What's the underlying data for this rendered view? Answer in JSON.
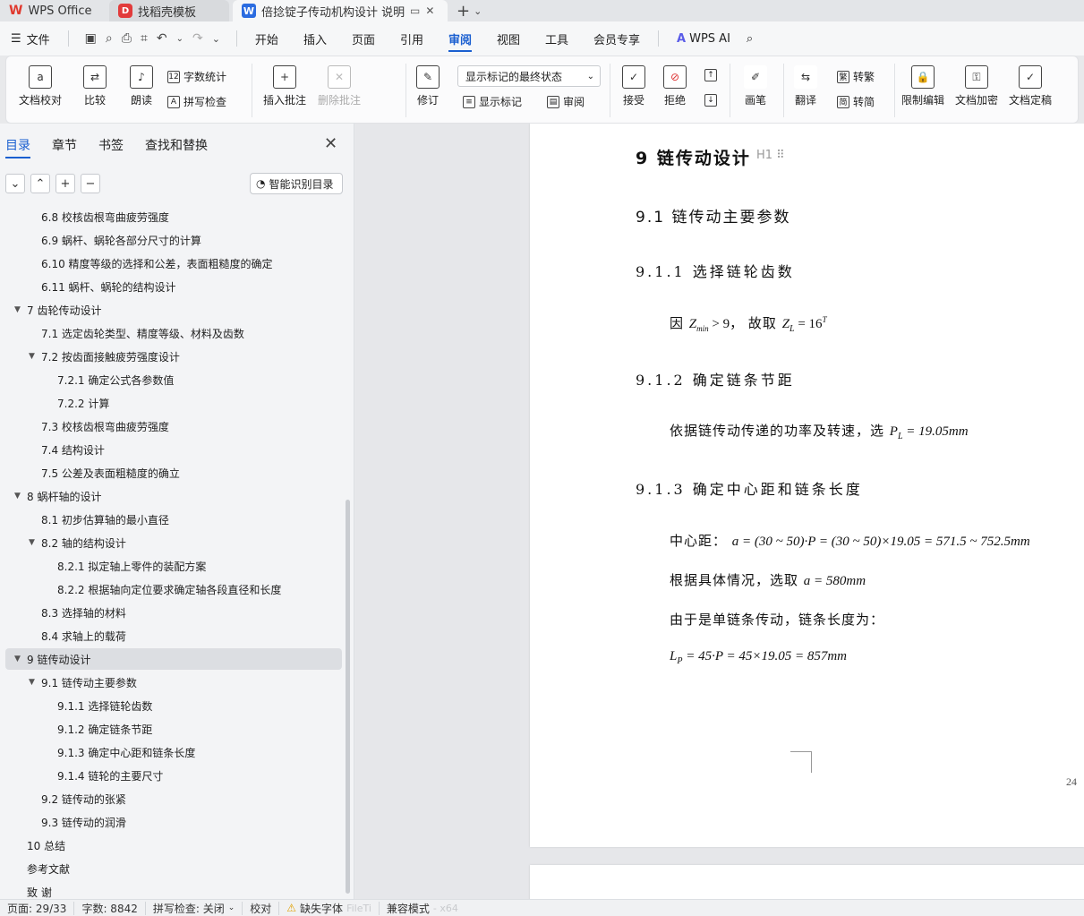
{
  "tabs": [
    {
      "label": "WPS Office"
    },
    {
      "label": "找稻壳模板"
    },
    {
      "label": "倍捻锭子传动机构设计 说明书"
    }
  ],
  "menu": {
    "file": "文件",
    "items": [
      "开始",
      "插入",
      "页面",
      "引用",
      "审阅",
      "视图",
      "工具",
      "会员专享"
    ],
    "active": "审阅",
    "ai": "WPS AI"
  },
  "ribbon": {
    "proofread": "文档校对",
    "compare": "比较",
    "read_aloud": "朗读",
    "word_count": "字数统计",
    "spell_check": "拼写检查",
    "insert_comment": "插入批注",
    "delete_comment": "删除批注",
    "markup_state": "显示标记的最终状态",
    "track": "修订",
    "show_markup": "显示标记",
    "review": "审阅",
    "accept": "接受",
    "reject": "拒绝",
    "pen": "画笔",
    "translate": "翻译",
    "to_traditional": "转繁",
    "to_simplified": "转简",
    "restrict": "限制编辑",
    "encrypt": "文档加密",
    "finalize": "文档定稿"
  },
  "sidebar": {
    "tabs": [
      "目录",
      "章节",
      "书签",
      "查找和替换"
    ],
    "active_tab": "目录",
    "smart_toc": "智能识别目录",
    "items": [
      {
        "text": "6.8  校核齿根弯曲疲劳强度",
        "level": 2,
        "arrow": ""
      },
      {
        "text": "6.9  蜗杆、蜗轮各部分尺寸的计算",
        "level": 2,
        "arrow": ""
      },
      {
        "text": "6.10  精度等级的选择和公差，表面粗糙度的确定",
        "level": 2,
        "arrow": ""
      },
      {
        "text": "6.11  蜗杆、蜗轮的结构设计",
        "level": 2,
        "arrow": ""
      },
      {
        "text": "7  齿轮传动设计",
        "level": 1,
        "arrow": "▼"
      },
      {
        "text": "7.1  选定齿轮类型、精度等级、材料及齿数",
        "level": 2,
        "arrow": ""
      },
      {
        "text": "7.2  按齿面接触疲劳强度设计",
        "level": 2,
        "arrow": "▼"
      },
      {
        "text": "7.2.1  确定公式各参数值",
        "level": 3,
        "arrow": ""
      },
      {
        "text": "7.2.2  计算",
        "level": 3,
        "arrow": ""
      },
      {
        "text": "7.3  校核齿根弯曲疲劳强度",
        "level": 2,
        "arrow": ""
      },
      {
        "text": "7.4  结构设计",
        "level": 2,
        "arrow": ""
      },
      {
        "text": "7.5  公差及表面粗糙度的确立",
        "level": 2,
        "arrow": ""
      },
      {
        "text": "8  蜗杆轴的设计",
        "level": 1,
        "arrow": "▼"
      },
      {
        "text": "8.1  初步估算轴的最小直径",
        "level": 2,
        "arrow": ""
      },
      {
        "text": "8.2  轴的结构设计",
        "level": 2,
        "arrow": "▼"
      },
      {
        "text": "8.2.1  拟定轴上零件的装配方案",
        "level": 3,
        "arrow": ""
      },
      {
        "text": "8.2.2  根据轴向定位要求确定轴各段直径和长度",
        "level": 3,
        "arrow": ""
      },
      {
        "text": "8.3  选择轴的材料",
        "level": 2,
        "arrow": ""
      },
      {
        "text": "8.4  求轴上的载荷",
        "level": 2,
        "arrow": ""
      },
      {
        "text": "9  链传动设计",
        "level": 1,
        "arrow": "▼",
        "selected": true
      },
      {
        "text": "9.1  链传动主要参数",
        "level": 2,
        "arrow": "▼"
      },
      {
        "text": "9.1.1  选择链轮齿数",
        "level": 3,
        "arrow": ""
      },
      {
        "text": "9.1.2  确定链条节距",
        "level": 3,
        "arrow": ""
      },
      {
        "text": "9.1.3  确定中心距和链条长度",
        "level": 3,
        "arrow": ""
      },
      {
        "text": "9.1.4  链轮的主要尺寸",
        "level": 3,
        "arrow": ""
      },
      {
        "text": "9.2  链传动的张紧",
        "level": 2,
        "arrow": ""
      },
      {
        "text": "9.3  链传动的润滑",
        "level": 2,
        "arrow": ""
      },
      {
        "text": "10  总结",
        "level": 1,
        "arrow": ""
      },
      {
        "text": "参考文献",
        "level": 1,
        "arrow": ""
      },
      {
        "text": "致  谢",
        "level": 1,
        "arrow": ""
      }
    ]
  },
  "document": {
    "heading_marker": "H1",
    "h1": "9  链传动设计",
    "h2": "9.1  链传动主要参数",
    "h3_1": "9.1.1  选择链轮齿数",
    "p1_a": "因",
    "p1_math1": "Z",
    "p1_sub1": "min",
    "p1_math2": " > 9，",
    "p1_b": "故取",
    "p1_math3": "Z",
    "p1_sub2": "L",
    "p1_math4": " = 16",
    "p1_sup": "T",
    "h3_2": "9.1.2  确定链条节距",
    "p2_text": "依据链传动传递的功率及转速，选",
    "p2_math": "P",
    "p2_sub": "L",
    "p2_math2": " = 19.05mm",
    "h3_3": "9.1.3  确定中心距和链条长度",
    "p3_label": "中心距：",
    "p3_math": "a = (30 ~ 50)·P = (30 ~ 50)×19.05 = 571.5 ~ 752.5mm",
    "p4_text": "根据具体情况，选取",
    "p4_math": "a = 580mm",
    "p5_text": "由于是单链条传动，链条长度为：",
    "p6_math1": "L",
    "p6_sub": "P",
    "p6_math2": " = 45·P = 45×19.05 = 857mm",
    "page_number": "24"
  },
  "status": {
    "page": "页面: 29/33",
    "words": "字数: 8842",
    "spell": "拼写检查: 关闭",
    "proof": "校对",
    "missing_font": "缺失字体",
    "compat": "兼容模式",
    "ghost": "FileTi",
    "arch": "- x64"
  }
}
